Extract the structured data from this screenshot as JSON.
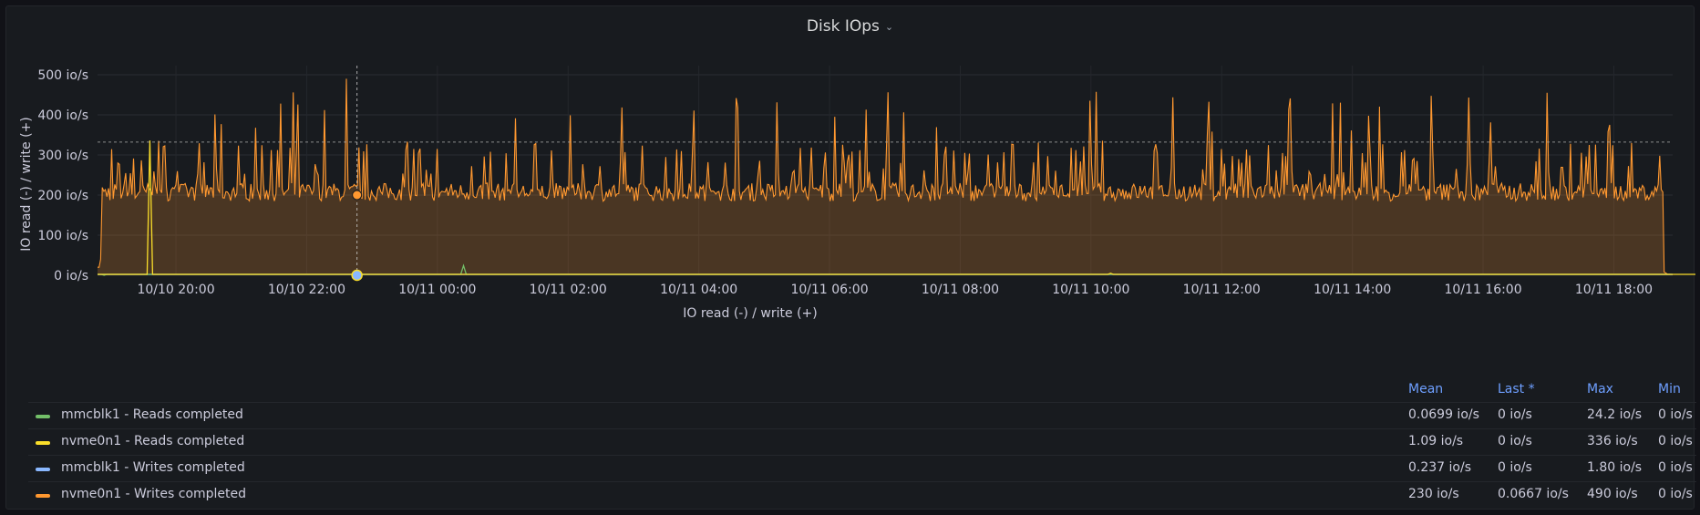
{
  "panel": {
    "title": "Disk IOps"
  },
  "chart_data": {
    "type": "line",
    "ylabel": "IO read (-) / write (+)",
    "xlabel": "IO read (-) / write (+)",
    "unit": "io/s",
    "ylim": [
      0,
      500
    ],
    "yticks": [
      "0 io/s",
      "100 io/s",
      "200 io/s",
      "300 io/s",
      "400 io/s",
      "500 io/s"
    ],
    "xticks": [
      "10/10 20:00",
      "10/10 22:00",
      "10/11 00:00",
      "10/11 02:00",
      "10/11 04:00",
      "10/11 06:00",
      "10/11 08:00",
      "10/11 10:00",
      "10/11 12:00",
      "10/11 14:00",
      "10/11 16:00",
      "10/11 18:00"
    ],
    "xlim_hours": [
      18.8,
      42.9
    ],
    "threshold": 332,
    "cursor_hour": 22.77,
    "grid": true,
    "legend_position": "bottom",
    "series": [
      {
        "name": "mmcblk1 - Reads completed",
        "color": "#73bf69",
        "spikes": [
          [
            0.0,
            18.9
          ],
          [
            24.2,
            24.4
          ]
        ]
      },
      {
        "name": "nvme0n1 - Reads completed",
        "color": "#fade2a",
        "spikes": [
          [
            336,
            19.6
          ],
          [
            5,
            34.3
          ],
          [
            4,
            43.5
          ],
          [
            5,
            57.8
          ]
        ]
      },
      {
        "name": "mmcblk1 - Writes completed",
        "color": "#8ab8ff",
        "spikes": []
      },
      {
        "name": "nvme0n1 - Writes completed",
        "color": "#ff9830",
        "typical": 200,
        "max": 490,
        "mean": 230
      }
    ]
  },
  "legend": {
    "headers": {
      "mean": "Mean",
      "last": "Last *",
      "max": "Max",
      "min": "Min"
    },
    "rows": [
      {
        "name": "mmcblk1 - Reads completed",
        "mean": "0.0699 io/s",
        "last": "0 io/s",
        "max": "24.2 io/s",
        "min": "0 io/s",
        "color": "#73bf69"
      },
      {
        "name": "nvme0n1 - Reads completed",
        "mean": "1.09 io/s",
        "last": "0 io/s",
        "max": "336 io/s",
        "min": "0 io/s",
        "color": "#fade2a"
      },
      {
        "name": "mmcblk1 - Writes completed",
        "mean": "0.237 io/s",
        "last": "0 io/s",
        "max": "1.80 io/s",
        "min": "0 io/s",
        "color": "#8ab8ff"
      },
      {
        "name": "nvme0n1 - Writes completed",
        "mean": "230 io/s",
        "last": "0.0667 io/s",
        "max": "490 io/s",
        "min": "0 io/s",
        "color": "#ff9830"
      }
    ]
  }
}
